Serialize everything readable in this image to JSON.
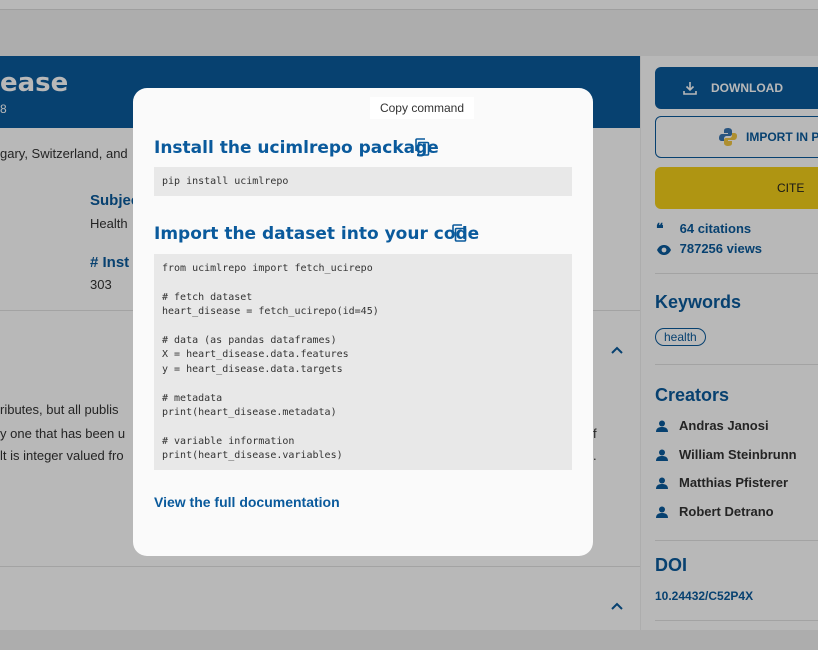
{
  "background": {
    "title_fragment": "ease",
    "subtitle_fragment": "8",
    "countries_fragment": "gary, Switzerland, and",
    "subject_label": "Subjec",
    "subject_value": "Health",
    "instances_label": "# Inst",
    "instances_value": "303",
    "para_lines": [
      "ributes, but all publis",
      "y one that has been u",
      "lt is integer valued fro"
    ],
    "para_right": [
      "f",
      "."
    ],
    "sidebar": {
      "download_label": "DOWNLOAD",
      "import_label": "IMPORT IN P",
      "cite_label": "CITE",
      "citations": "64 citations",
      "views": "787256 views",
      "keywords_heading": "Keywords",
      "keyword": "health",
      "creators_heading": "Creators",
      "creators": [
        "Andras Janosi",
        "William Steinbrunn",
        "Matthias Pfisterer",
        "Robert Detrano"
      ],
      "doi_heading": "DOI",
      "doi_value": "10.24432/C52P4X"
    }
  },
  "modal": {
    "tooltip": "Copy command",
    "install_heading": "Install the ucimlrepo package",
    "install_code": "pip install ucimlrepo",
    "import_heading": "Import the dataset into your code",
    "import_code_lines": [
      "from ucimlrepo import fetch_ucirepo",
      "",
      "# fetch dataset",
      "heart_disease = fetch_ucirepo(id=45)",
      "",
      "# data (as pandas dataframes)",
      "X = heart_disease.data.features",
      "y = heart_disease.data.targets",
      "",
      "# metadata",
      "print(heart_disease.metadata)",
      "",
      "# variable information",
      "print(heart_disease.variables)"
    ],
    "doc_link": "View the full documentation"
  },
  "colors": {
    "primary": "#0a5a9c",
    "cite": "#f3cf19"
  }
}
